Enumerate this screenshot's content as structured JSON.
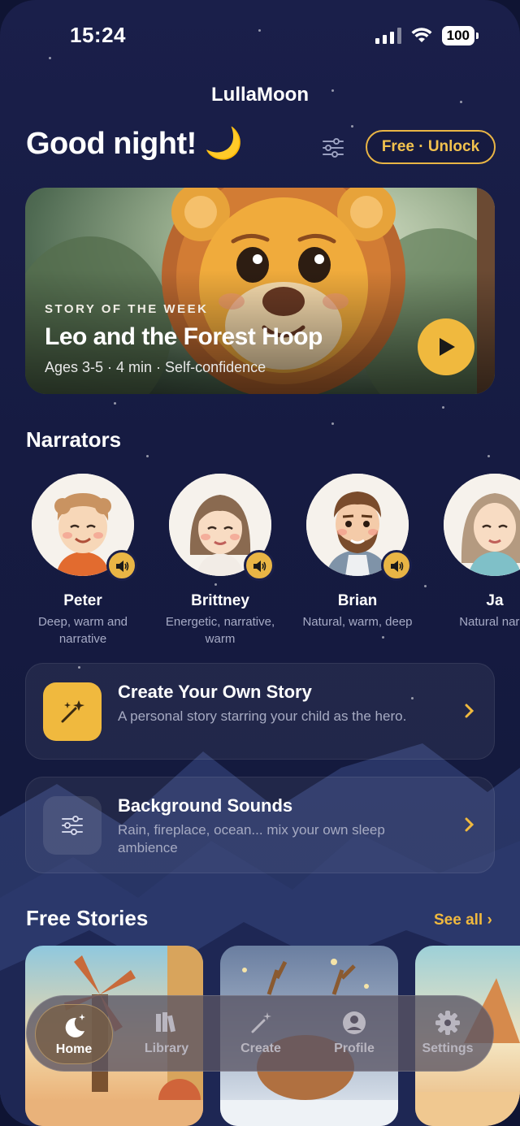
{
  "status": {
    "time": "15:24",
    "battery": "100"
  },
  "app_title": "LullaMoon",
  "greeting": "Good night! 🌙",
  "unlock_label": "Free · Unlock",
  "hero": {
    "kicker": "STORY OF THE WEEK",
    "title": "Leo and the Forest Hoop",
    "meta": "Ages 3-5 · 4 min · Self-confidence"
  },
  "narrators_title": "Narrators",
  "narrators": [
    {
      "name": "Peter",
      "desc": "Deep, warm and narrative"
    },
    {
      "name": "Brittney",
      "desc": "Energetic, narrative, warm"
    },
    {
      "name": "Brian",
      "desc": "Natural, warm, deep"
    },
    {
      "name": "Ja",
      "desc": "Natural narra"
    }
  ],
  "cards": [
    {
      "title": "Create Your Own Story",
      "subtitle": "A personal story starring your child as the hero."
    },
    {
      "title": "Background Sounds",
      "subtitle": "Rain, fireplace, ocean... mix your own sleep ambience"
    }
  ],
  "free_stories_title": "Free Stories",
  "see_all": "See all ›",
  "nav": [
    {
      "label": "Home",
      "icon": "moon-stars-icon",
      "active": true
    },
    {
      "label": "Library",
      "icon": "books-icon"
    },
    {
      "label": "Create",
      "icon": "magic-wand-icon"
    },
    {
      "label": "Profile",
      "icon": "profile-icon"
    },
    {
      "label": "Settings",
      "icon": "gear-icon"
    }
  ],
  "colors": {
    "accent": "#f0b93e",
    "background": "#161b42"
  }
}
